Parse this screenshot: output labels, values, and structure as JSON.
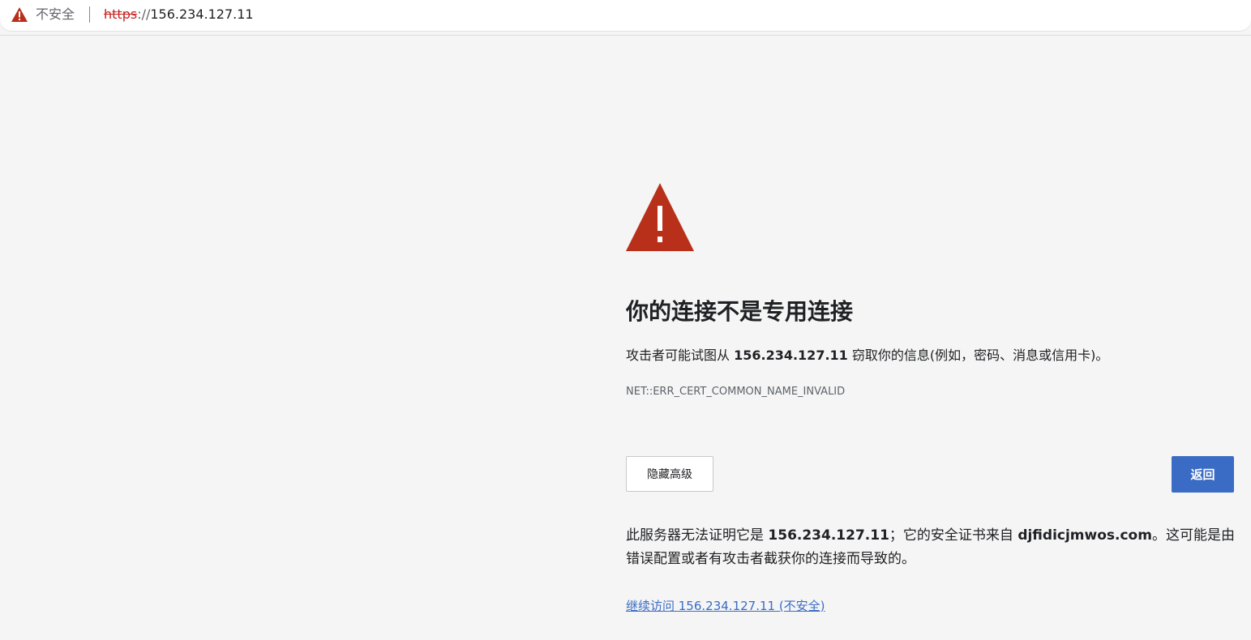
{
  "address_bar": {
    "security_label": "不安全",
    "url_scheme": "https",
    "url_separator": "://",
    "url_host": "156.234.127.11",
    "icon": "warning-triangle-icon"
  },
  "main": {
    "icon": "warning-triangle-icon",
    "title": "你的连接不是专用连接",
    "description": {
      "prefix": "攻击者可能试图从 ",
      "host": "156.234.127.11",
      "suffix": " 窃取你的信息(例如，密码、消息或信用卡)。"
    },
    "error_code": "NET::ERR_CERT_COMMON_NAME_INVALID",
    "advanced_button_label": "隐藏高级",
    "back_button_label": "返回",
    "details": {
      "part1": "此服务器无法证明它是 ",
      "host": "156.234.127.11",
      "part2": "；它的安全证书来自 ",
      "cert_domain": "djfidicjmwos.com",
      "part3": "。这可能是由错误配置或者有攻击者截获你的连接而导致的。"
    },
    "proceed_link": "继续访问 156.234.127.11 (不安全)"
  },
  "colors": {
    "warning_red": "#b9301a",
    "primary_blue": "#3a6cc5",
    "background": "#f5f5f5"
  }
}
